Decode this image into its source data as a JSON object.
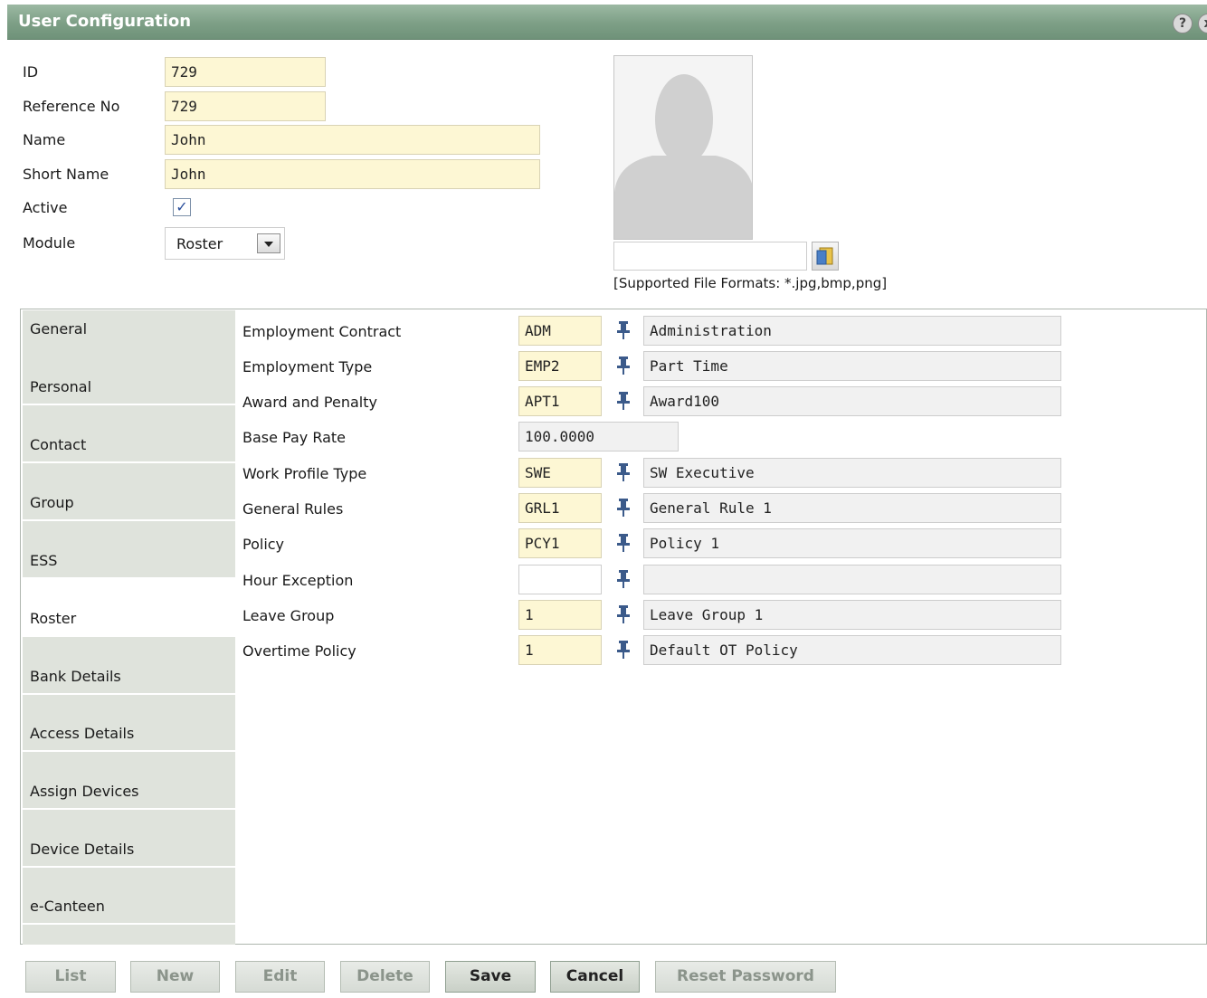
{
  "window": {
    "title": "User Configuration",
    "help_label": "?",
    "close_label": "x"
  },
  "form": {
    "id_label": "ID",
    "id_value": "729",
    "ref_label": "Reference No",
    "ref_value": "729",
    "name_label": "Name",
    "name_value": "John",
    "short_label": "Short Name",
    "short_value": "John",
    "active_label": "Active",
    "active_checked": true,
    "module_label": "Module",
    "module_value": "Roster"
  },
  "photo": {
    "hint": "[Supported File Formats: *.jpg,bmp,png]"
  },
  "tabs": [
    {
      "label": "General"
    },
    {
      "label": "Personal"
    },
    {
      "label": "Contact"
    },
    {
      "label": "Group"
    },
    {
      "label": "ESS"
    },
    {
      "label": "Roster"
    },
    {
      "label": "Bank Details"
    },
    {
      "label": "Access Details"
    },
    {
      "label": "Assign Devices"
    },
    {
      "label": "Device Details"
    },
    {
      "label": "e-Canteen"
    }
  ],
  "active_tab": "Roster",
  "roster": [
    {
      "label": "Employment Contract",
      "code": "ADM",
      "desc": "Administration"
    },
    {
      "label": "Employment Type",
      "code": "EMP2",
      "desc": "Part Time"
    },
    {
      "label": "Award and Penalty",
      "code": "APT1",
      "desc": "Award100"
    },
    {
      "label": "Base Pay Rate",
      "code": "100.0000"
    },
    {
      "label": "Work Profile Type",
      "code": "SWE",
      "desc": "SW Executive"
    },
    {
      "label": "General Rules",
      "code": "GRL1",
      "desc": "General Rule 1"
    },
    {
      "label": "Policy",
      "code": "PCY1",
      "desc": "Policy 1"
    },
    {
      "label": "Hour Exception",
      "code": "",
      "desc": ""
    },
    {
      "label": "Leave Group",
      "code": "1",
      "desc": "Leave Group 1"
    },
    {
      "label": "Overtime Policy",
      "code": "1",
      "desc": "Default OT Policy"
    }
  ],
  "buttons": {
    "list": "List",
    "new": "New",
    "edit": "Edit",
    "delete": "Delete",
    "save": "Save",
    "cancel": "Cancel",
    "reset_password": "Reset Password"
  },
  "colors": {
    "title_bar": "#7d9f86",
    "field_yellow": "#fdf7d4",
    "tab_bg": "#dfe3dc"
  }
}
